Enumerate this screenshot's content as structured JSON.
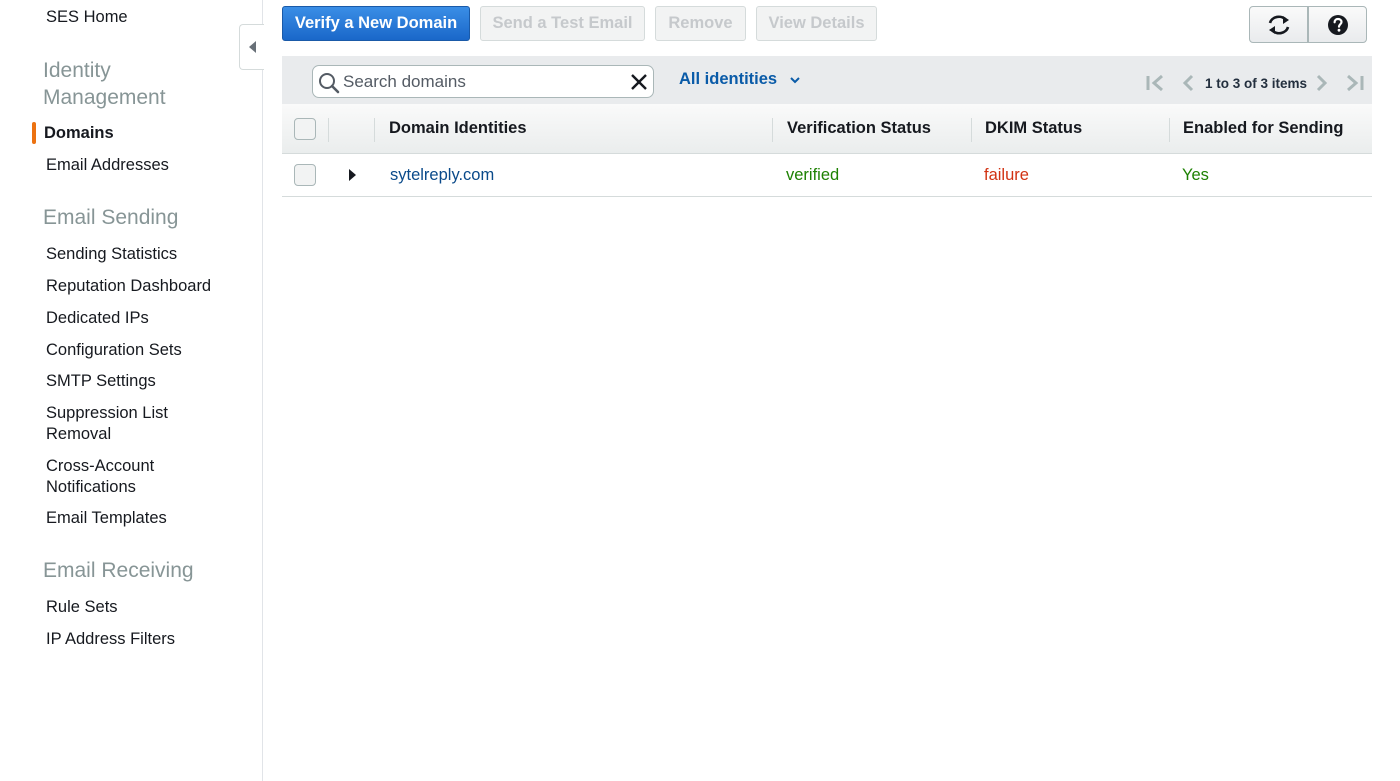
{
  "sidebar": {
    "home_label": "SES Home",
    "sections": [
      {
        "title": "Identity Management",
        "items": [
          "Domains",
          "Email Addresses"
        ]
      },
      {
        "title": "Email Sending",
        "items": [
          "Sending Statistics",
          "Reputation Dashboard",
          "Dedicated IPs",
          "Configuration Sets",
          "SMTP Settings",
          "Suppression List Removal",
          "Cross-Account Notifications",
          "Email Templates"
        ]
      },
      {
        "title": "Email Receiving",
        "items": [
          "Rule Sets",
          "IP Address Filters"
        ]
      }
    ],
    "identity_title_line1": "Identity",
    "identity_title_line2": "Management",
    "suppression_line1": "Suppression List",
    "suppression_line2": "Removal",
    "crossaccount_line1": "Cross-Account",
    "crossaccount_line2": "Notifications",
    "active_item": "Domains"
  },
  "toolbar": {
    "verify_label": "Verify a New Domain",
    "test_email_label": "Send a Test Email",
    "remove_label": "Remove",
    "view_details_label": "View Details",
    "refresh_icon": "refresh-icon",
    "help_icon": "help-icon"
  },
  "filter": {
    "search_placeholder": "Search domains",
    "search_value": "",
    "filter_selected": "All identities",
    "pager_text": "1 to 3 of 3 items"
  },
  "table": {
    "columns": [
      "Domain Identities",
      "Verification Status",
      "DKIM Status",
      "Enabled for Sending"
    ],
    "rows": [
      {
        "domain": "sytelreply.com",
        "verification": "verified",
        "dkim": "failure",
        "enabled": "Yes"
      }
    ]
  },
  "colors": {
    "accent_orange": "#ec7211",
    "primary_blue": "#1a67c9",
    "link_blue": "#0a5ba8",
    "status_green": "#1d8102",
    "status_red": "#d13212"
  }
}
